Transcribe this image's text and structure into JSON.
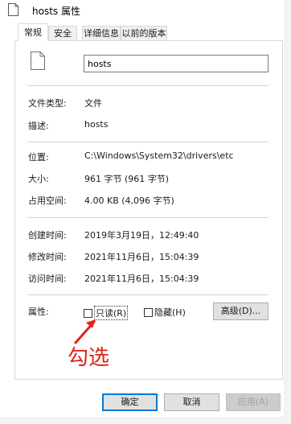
{
  "window": {
    "title": "hosts 属性"
  },
  "tabs": [
    {
      "label": "常规",
      "active": true
    },
    {
      "label": "安全",
      "active": false
    },
    {
      "label": "详细信息",
      "active": false
    },
    {
      "label": "以前的版本",
      "active": false
    }
  ],
  "general": {
    "file_name": "hosts",
    "rows": [
      {
        "label": "文件类型:",
        "value": "文件"
      },
      {
        "label": "描述:",
        "value": "hosts"
      },
      {
        "label": "位置:",
        "value": "C:\\Windows\\System32\\drivers\\etc"
      },
      {
        "label": "大小:",
        "value": "961 字节 (961 字节)"
      },
      {
        "label": "占用空间:",
        "value": "4.00 KB (4,096 字节)"
      },
      {
        "label": "创建时间:",
        "value": "2019年3月19日，12:49:40"
      },
      {
        "label": "修改时间:",
        "value": "2021年11月6日，15:04:39"
      },
      {
        "label": "访问时间:",
        "value": "2021年11月6日，15:04:39"
      }
    ],
    "attributes_label": "属性:",
    "readonly_label": "只读(R)",
    "hidden_label": "隐藏(H)",
    "advanced_label": "高级(D)..."
  },
  "annotation": {
    "text": "勾选",
    "color": "#e0231b"
  },
  "buttons": {
    "ok": "确定",
    "cancel": "取消",
    "apply": "应用(A)"
  }
}
